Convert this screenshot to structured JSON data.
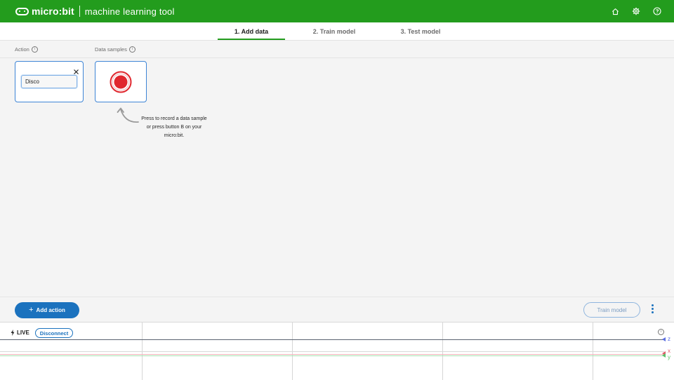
{
  "header": {
    "brand": "micro:bit",
    "app_title": "machine learning tool",
    "icons": [
      "home-icon",
      "settings-icon",
      "help-icon"
    ],
    "background": "#239c1d"
  },
  "tabs": [
    {
      "label": "1. Add data",
      "active": true
    },
    {
      "label": "2. Train model",
      "active": false
    },
    {
      "label": "3. Test model",
      "active": false
    }
  ],
  "columns": {
    "action": "Action",
    "data_samples": "Data samples"
  },
  "action_card": {
    "name_value": "Disco"
  },
  "record_hint": "Press to record a data sample or press button B on your micro:bit.",
  "bottom_bar": {
    "add_action": "Add action",
    "train_model": "Train model"
  },
  "live_graph": {
    "live_label": "LIVE",
    "disconnect": "Disconnect",
    "axes": [
      {
        "name": "z",
        "color": "#5b6ee1"
      },
      {
        "name": "x",
        "color": "#e35b6a"
      },
      {
        "name": "y",
        "color": "#5cc06b"
      }
    ]
  },
  "colors": {
    "accent_green": "#239c1d",
    "accent_blue": "#1b72be",
    "record_red": "#e0272e"
  }
}
